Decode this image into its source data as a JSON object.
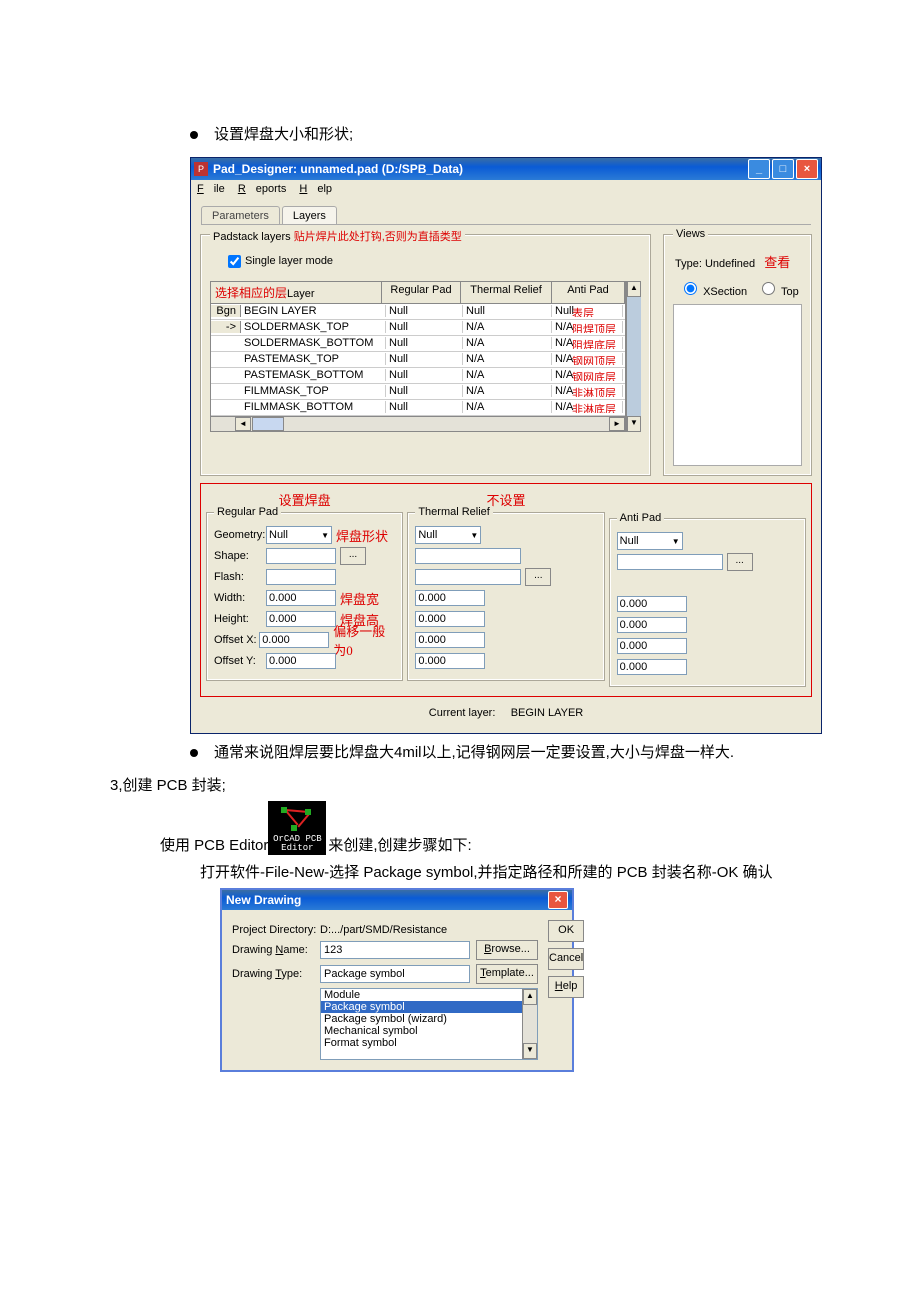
{
  "doc": {
    "bullet1": "设置焊盘大小和形状;",
    "bullet2": "通常来说阻焊层要比焊盘大4mil以上,记得钢网层一定要设置,大小与焊盘一样大.",
    "line3": "3,创建 PCB 封装;",
    "use_editor_prefix": "使用 PCB Editor",
    "use_editor_suffix": "来创建,创建步骤如下:",
    "open_steps": "打开软件-File-New-选择 Package symbol,并指定路径和所建的 PCB 封装名称-OK 确认"
  },
  "orcad_icon": {
    "line1": "OrCAD PCB",
    "line2": "Editor"
  },
  "pad": {
    "title": "Pad_Designer: unnamed.pad (D:/SPB_Data)",
    "menu": {
      "file": "File",
      "reports": "Reports",
      "help": "Help"
    },
    "tabs": {
      "parameters": "Parameters",
      "layers": "Layers"
    },
    "padstack_label": "Padstack layers",
    "padstack_anno": " 贴片焊片此处打钩,否则为直插类型",
    "single_layer": "Single layer mode",
    "select_layer_anno": "选择相应的层",
    "layer_header": "Layer",
    "col_reg": "Regular Pad",
    "col_thermal": "Thermal Relief",
    "col_anti": "Anti Pad",
    "rows": [
      {
        "ind": "Bgn",
        "layer": "BEGIN LAYER",
        "reg": "Null",
        "th": "Null",
        "anti": "Null",
        "anno": "表层"
      },
      {
        "ind": "->",
        "layer": "SOLDERMASK_TOP",
        "reg": "Null",
        "th": "N/A",
        "anti": "N/A",
        "anno": "阻焊顶层"
      },
      {
        "ind": "",
        "layer": "SOLDERMASK_BOTTOM",
        "reg": "Null",
        "th": "N/A",
        "anti": "N/A",
        "anno": "阻焊底层"
      },
      {
        "ind": "",
        "layer": "PASTEMASK_TOP",
        "reg": "Null",
        "th": "N/A",
        "anti": "N/A",
        "anno": "钢网顶层"
      },
      {
        "ind": "",
        "layer": "PASTEMASK_BOTTOM",
        "reg": "Null",
        "th": "N/A",
        "anti": "N/A",
        "anno": "钢网底层"
      },
      {
        "ind": "",
        "layer": "FILMMASK_TOP",
        "reg": "Null",
        "th": "N/A",
        "anti": "N/A",
        "anno": "非淋顶层"
      },
      {
        "ind": "",
        "layer": "FILMMASK_BOTTOM",
        "reg": "Null",
        "th": "N/A",
        "anti": "N/A",
        "anno": "非淋底层"
      }
    ],
    "heading_set": "设置焊盘",
    "heading_noset": "不设置",
    "regpad_label": "Regular Pad",
    "thermal_label": "Thermal Relief",
    "antipad_label": "Anti Pad",
    "geom_anno": "焊盘形状",
    "width_anno": "焊盘宽",
    "height_anno": "焊盘高",
    "offset_anno": "偏移一般为0",
    "f_geometry": "Geometry:",
    "f_shape": "Shape:",
    "f_flash": "Flash:",
    "f_width": "Width:",
    "f_height": "Height:",
    "f_offx": "Offset X:",
    "f_offy": "Offset Y:",
    "val_null": "Null",
    "val_zero": "0.000",
    "dots": "...",
    "current_layer_label": "Current layer:",
    "current_layer_value": "BEGIN LAYER",
    "views_label": "Views",
    "views_type": "Type:  Undefined",
    "views_look": "查看",
    "views_xsection": "XSection",
    "views_top": "Top"
  },
  "dlg": {
    "title": "New Drawing",
    "close": "×",
    "proj_dir_label": "Project Directory:",
    "proj_dir_value": "D:.../part/SMD/Resistance",
    "name_label": "Drawing Name:",
    "name_value": "123",
    "type_label": "Drawing Type:",
    "type_value": "Package symbol",
    "items": [
      "Module",
      "Package symbol",
      "Package symbol (wizard)",
      "Mechanical symbol",
      "Format symbol"
    ],
    "browse": "Browse...",
    "template": "Template...",
    "ok": "OK",
    "cancel": "Cancel",
    "help": "Help"
  }
}
